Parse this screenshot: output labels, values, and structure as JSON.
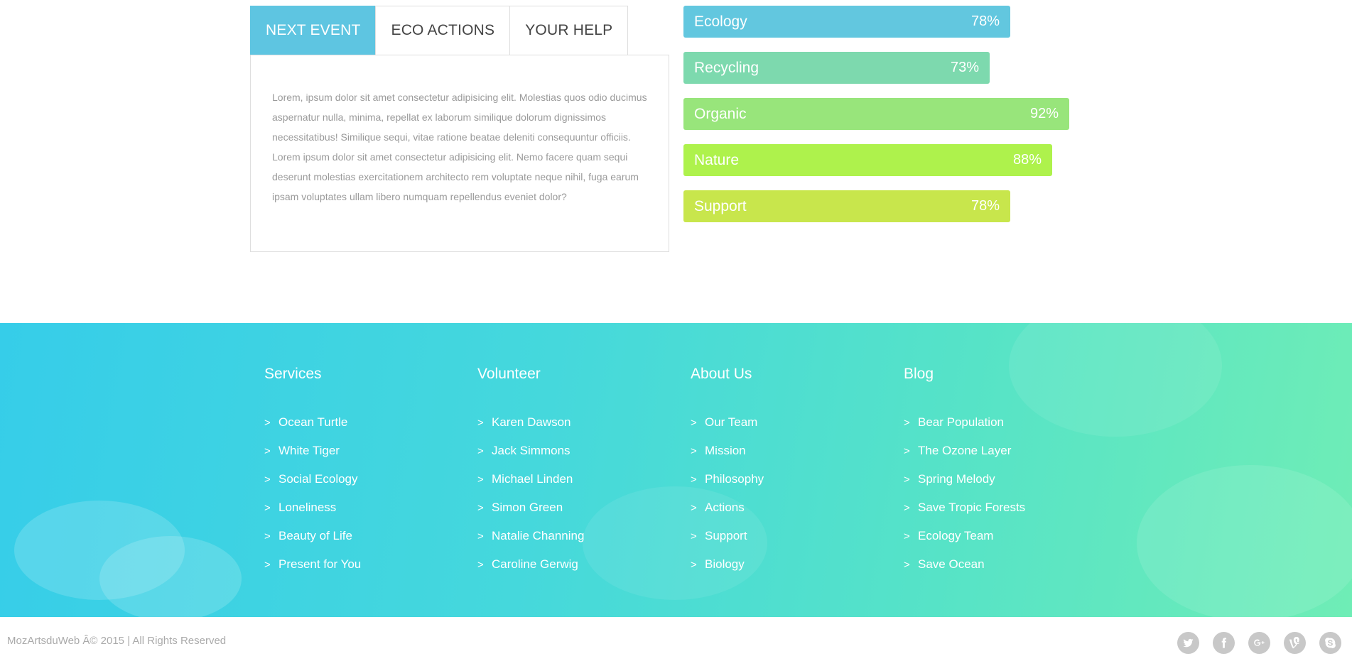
{
  "tabs": [
    {
      "label": "NEXT EVENT"
    },
    {
      "label": "ECO ACTIONS"
    },
    {
      "label": "YOUR HELP"
    }
  ],
  "tab_content": "Lorem, ipsum dolor sit amet consectetur adipisicing elit. Molestias quos odio ducimus aspernatur nulla, minima, repellat ex laborum similique dolorum dignissimos necessitatibus! Similique sequi, vitae ratione beatae deleniti consequuntur officiis. Lorem ipsum dolor sit amet consectetur adipisicing elit. Nemo facere quam sequi deserunt molestias exercitationem architecto rem voluptate neque nihil, fuga earum ipsam voluptates ullam libero numquam repellendus eveniet dolor?",
  "skills": [
    {
      "label": "Ecology",
      "percent_text": "78%",
      "value": 78,
      "color": "#62c7df"
    },
    {
      "label": "Recycling",
      "percent_text": "73%",
      "value": 73,
      "color": "#7dd9ae"
    },
    {
      "label": "Organic",
      "percent_text": "92%",
      "value": 92,
      "color": "#98e57b"
    },
    {
      "label": "Nature",
      "percent_text": "88%",
      "value": 88,
      "color": "#aef24c"
    },
    {
      "label": "Support",
      "percent_text": "78%",
      "value": 78,
      "color": "#c8e64c"
    }
  ],
  "footer": {
    "columns": [
      {
        "title": "Services",
        "items": [
          "Ocean Turtle",
          "White Tiger",
          "Social Ecology",
          "Loneliness",
          "Beauty of Life",
          "Present for You"
        ]
      },
      {
        "title": "Volunteer",
        "items": [
          "Karen Dawson",
          "Jack Simmons",
          "Michael Linden",
          "Simon Green",
          "Natalie Channing",
          "Caroline Gerwig"
        ]
      },
      {
        "title": "About Us",
        "items": [
          "Our Team",
          "Mission",
          "Philosophy",
          "Actions",
          "Support",
          "Biology"
        ]
      },
      {
        "title": "Blog",
        "items": [
          "Bear Population",
          "The Ozone Layer",
          "Spring Melody",
          "Save Tropic Forests",
          "Ecology Team",
          "Save Ocean"
        ]
      }
    ],
    "arrow": ">"
  },
  "bottom": {
    "copyright": "MozArtsduWeb Â© 2015 | All Rights Reserved",
    "social": [
      "twitter-icon",
      "facebook-icon",
      "google-plus-icon",
      "vine-icon",
      "skype-icon"
    ]
  }
}
